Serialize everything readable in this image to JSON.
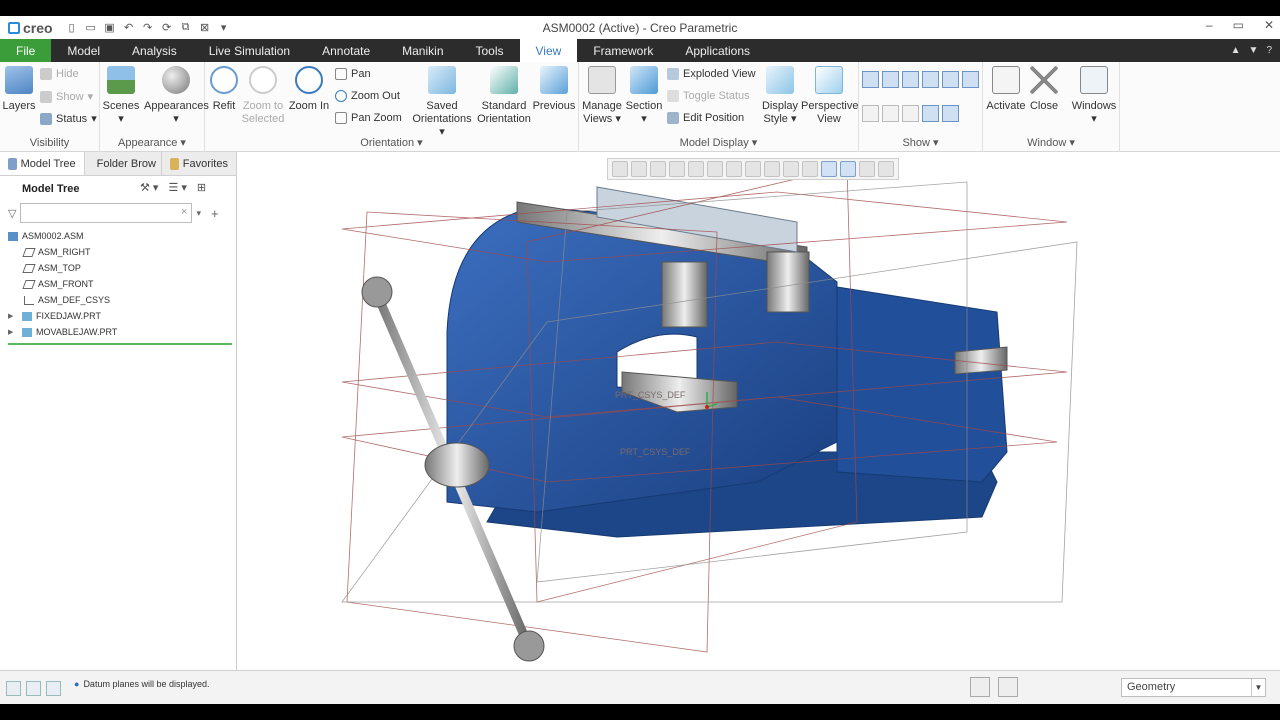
{
  "app": {
    "logo_text": "creo",
    "window_title": "ASM0002 (Active) - Creo Parametric",
    "window_controls": [
      "–",
      "▭",
      "✕"
    ]
  },
  "tabs": [
    "File",
    "Model",
    "Analysis",
    "Live Simulation",
    "Annotate",
    "Manikin",
    "Tools",
    "View",
    "Framework",
    "Applications"
  ],
  "active_tab": "View",
  "ribbon": {
    "visibility": {
      "label": "Visibility",
      "layers": "Layers",
      "hide": "Hide",
      "show": "Show",
      "status": "Status"
    },
    "appearance": {
      "label": "Appearance",
      "scenes": "Scenes",
      "appearances": "Appearances"
    },
    "orientation": {
      "label": "Orientation",
      "refit": "Refit",
      "zoom_to_selected_1": "Zoom to",
      "zoom_to_selected_2": "Selected",
      "zoom_in": "Zoom In",
      "pan": "Pan",
      "zoom_out": "Zoom Out",
      "pan_zoom": "Pan Zoom",
      "saved_1": "Saved",
      "saved_2": "Orientations",
      "standard_1": "Standard",
      "standard_2": "Orientation",
      "previous": "Previous"
    },
    "model_display": {
      "label": "Model Display",
      "manage_views_1": "Manage",
      "manage_views_2": "Views",
      "section": "Section",
      "exploded_view": "Exploded View",
      "toggle_status": "Toggle Status",
      "edit_position": "Edit Position",
      "display_style_1": "Display",
      "display_style_2": "Style",
      "perspective_1": "Perspective",
      "perspective_2": "View"
    },
    "show": {
      "label": "Show"
    },
    "window": {
      "label": "Window",
      "activate": "Activate",
      "close": "Close",
      "windows": "Windows"
    }
  },
  "panel": {
    "tabs": [
      "Model Tree",
      "Folder Brow",
      "Favorites"
    ],
    "header": "Model Tree",
    "filter_placeholder": "",
    "tree": [
      {
        "label": "ASM0002.ASM",
        "indent": 0,
        "expand": ""
      },
      {
        "label": "ASM_RIGHT",
        "indent": 1,
        "expand": ""
      },
      {
        "label": "ASM_TOP",
        "indent": 1,
        "expand": ""
      },
      {
        "label": "ASM_FRONT",
        "indent": 1,
        "expand": ""
      },
      {
        "label": "ASM_DEF_CSYS",
        "indent": 1,
        "expand": ""
      },
      {
        "label": "FIXEDJAW.PRT",
        "indent": 1,
        "expand": "▶"
      },
      {
        "label": "MOVABLEJAW.PRT",
        "indent": 1,
        "expand": "▶"
      }
    ]
  },
  "viewport": {
    "labels": [
      "PRT_CSYS_DEF",
      "PRT_CSYS_DEF"
    ]
  },
  "status": {
    "message": "Datum planes will be displayed.",
    "filter_value": "Geometry"
  },
  "colors": {
    "file_tab": "#3a9d3a",
    "accent": "#3a7ac0",
    "model_blue": "#1f4f9a",
    "datum_plane": "#a04848"
  }
}
